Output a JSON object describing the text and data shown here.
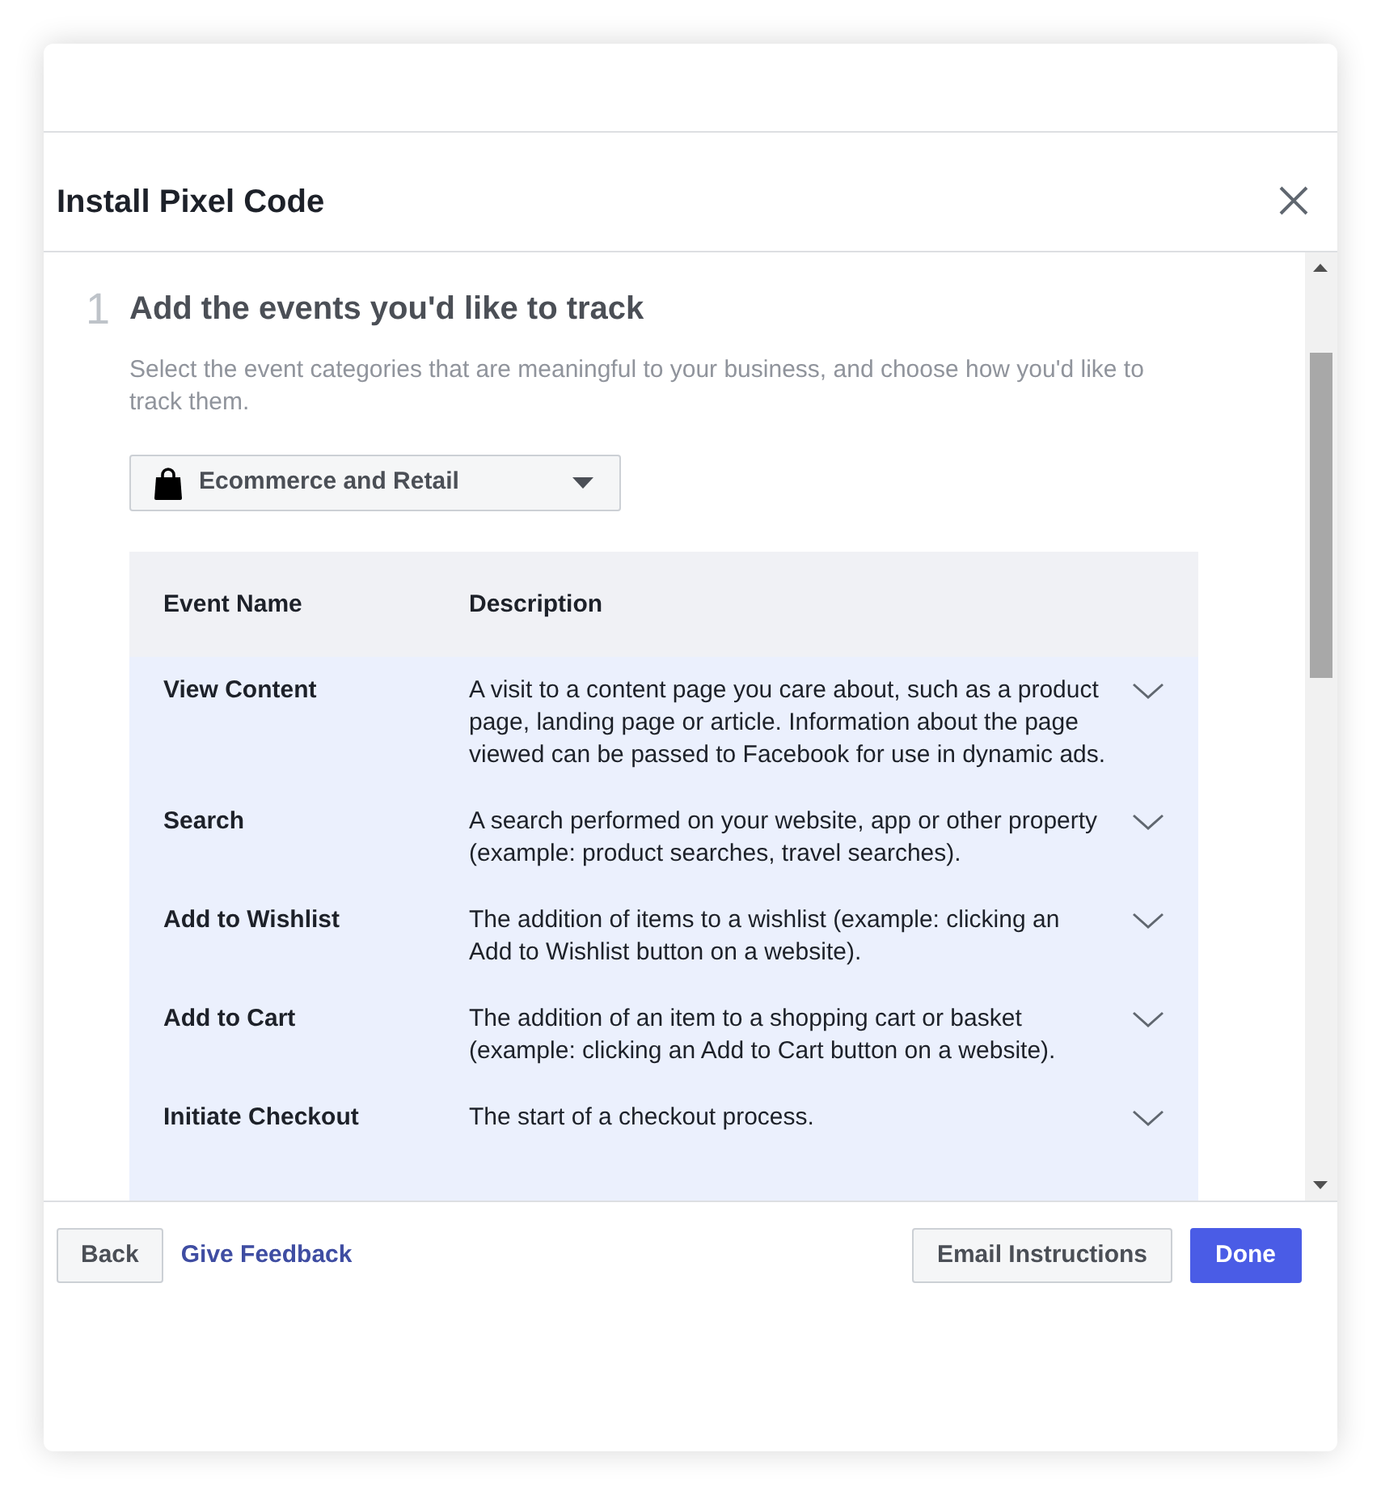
{
  "dialog": {
    "title": "Install Pixel Code"
  },
  "step": {
    "number": "1",
    "heading": "Add the events you'd like to track",
    "description": "Select the event categories that are meaningful to your business, and choose how you'd like to track them."
  },
  "category_dropdown": {
    "value": "Ecommerce and Retail"
  },
  "events_table": {
    "columns": [
      "Event Name",
      "Description"
    ],
    "rows": [
      {
        "name": "View Content",
        "description": "A visit to a content page you care about, such as a product page, landing page or article. Information about the page viewed can be passed to Facebook for use in dynamic ads.",
        "expanded": false
      },
      {
        "name": "Search",
        "description": "A search performed on your website, app or other property (example: product searches, travel searches).",
        "expanded": false
      },
      {
        "name": "Add to Wishlist",
        "description": "The addition of items to a wishlist (example: clicking an Add to Wishlist button on a website).",
        "expanded": false
      },
      {
        "name": "Add to Cart",
        "description": "The addition of an item to a shopping cart or basket (example: clicking an Add to Cart button on a website).",
        "expanded": false
      },
      {
        "name": "Initiate Checkout",
        "description": "The start of a checkout process.",
        "expanded": false
      }
    ]
  },
  "footer": {
    "left": [
      {
        "label": "Back",
        "kind": "secondary"
      },
      {
        "label": "Give Feedback",
        "kind": "link"
      }
    ],
    "right": [
      {
        "label": "Email Instructions",
        "kind": "secondary"
      },
      {
        "label": "Done",
        "kind": "primary"
      }
    ]
  }
}
